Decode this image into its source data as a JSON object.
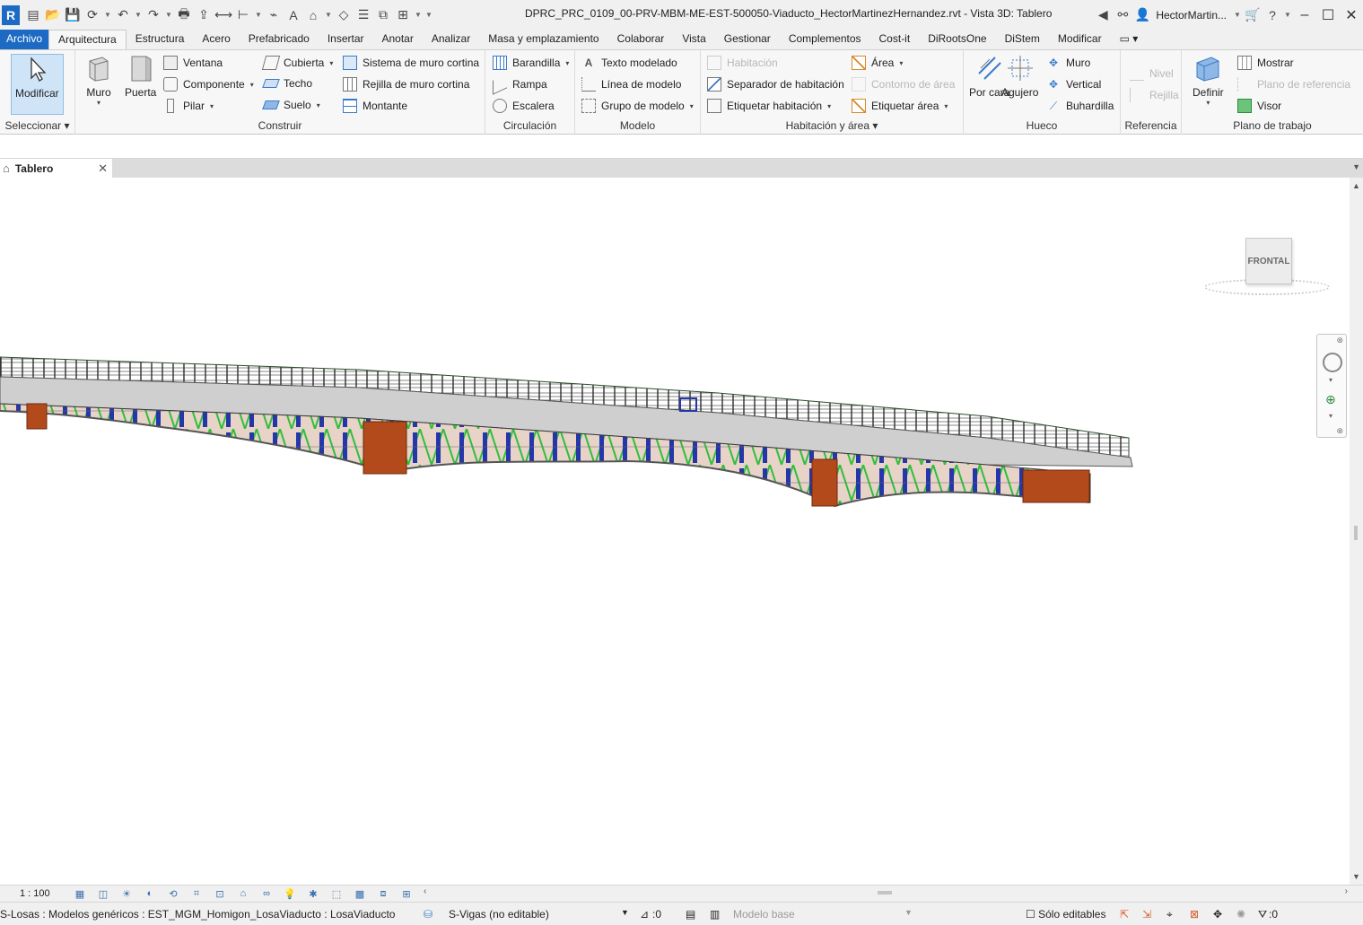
{
  "app": {
    "logo_letter": "R",
    "accent": "#1c6ac4"
  },
  "titlebar": {
    "title": "DPRC_PRC_0109_00-PRV-MBM-ME-EST-500050-Viaducto_HectorMartinezHernandez.rvt - Vista 3D: Tablero",
    "user": "HectorMartin...",
    "icons": [
      "open-icon",
      "save-icon",
      "sync-icon",
      "undo-icon",
      "redo-icon",
      "print-icon",
      "measure-icon",
      "dimension-icon",
      "text-icon",
      "3d-view-icon",
      "section-icon",
      "thin-lines-icon",
      "close-hidden-icon",
      "switch-windows-icon"
    ]
  },
  "menu": {
    "tabs": [
      "Archivo",
      "Arquitectura",
      "Estructura",
      "Acero",
      "Prefabricado",
      "Insertar",
      "Anotar",
      "Analizar",
      "Masa y emplazamiento",
      "Colaborar",
      "Vista",
      "Gestionar",
      "Complementos",
      "Cost-it",
      "DiRootsOne",
      "DiStem",
      "Modificar"
    ],
    "active": "Arquitectura"
  },
  "ribbon": {
    "seleccionar": {
      "title": "Seleccionar",
      "modificar": "Modificar"
    },
    "construir": {
      "title": "Construir",
      "muro": "Muro",
      "puerta": "Puerta",
      "ventana": "Ventana",
      "componente": "Componente",
      "pilar": "Pilar",
      "cubierta": "Cubierta",
      "techo": "Techo",
      "suelo": "Suelo",
      "sistema_muro_cortina": "Sistema de muro cortina",
      "rejilla_muro_cortina": "Rejilla de muro cortina",
      "montante": "Montante"
    },
    "circulacion": {
      "title": "Circulación",
      "barandilla": "Barandilla",
      "rampa": "Rampa",
      "escalera": "Escalera"
    },
    "modelo": {
      "title": "Modelo",
      "texto_modelado": "Texto modelado",
      "linea_modelo": "Línea de modelo",
      "grupo_modelo": "Grupo de modelo"
    },
    "habitacion": {
      "title": "Habitación y área",
      "habitacion": "Habitación",
      "separador": "Separador  de habitación",
      "etiquetar_habitacion": "Etiquetar  habitación",
      "area": "Área",
      "contorno_area": "Contorno  de área",
      "etiquetar_area": "Etiquetar  área"
    },
    "hueco": {
      "title": "Hueco",
      "por_cara": "Por cara",
      "agujero": "Agujero",
      "muro": "Muro",
      "vertical": "Vertical",
      "buhardilla": "Buhardilla"
    },
    "referencia": {
      "title": "Referencia",
      "nivel": "Nivel",
      "rejilla": "Rejilla"
    },
    "plano_trabajo": {
      "title": "Plano de trabajo",
      "definir": "Definir",
      "mostrar": "Mostrar",
      "plano_referencia": "Plano de referencia",
      "visor": "Visor"
    }
  },
  "document": {
    "tab_label": "Tablero"
  },
  "viewcube": {
    "face": "FRONTAL"
  },
  "viewbar": {
    "scale": "1 : 100"
  },
  "statusbar": {
    "selection": "S-Losas : Modelos genéricos : EST_MGM_Homigon_LosaViaducto : LosaViaducto",
    "workset": "S-Vigas (no editable)",
    "count": ":0",
    "design_option": "Modelo base",
    "editable_only": "Sólo editables",
    "filter_count": ":0"
  }
}
